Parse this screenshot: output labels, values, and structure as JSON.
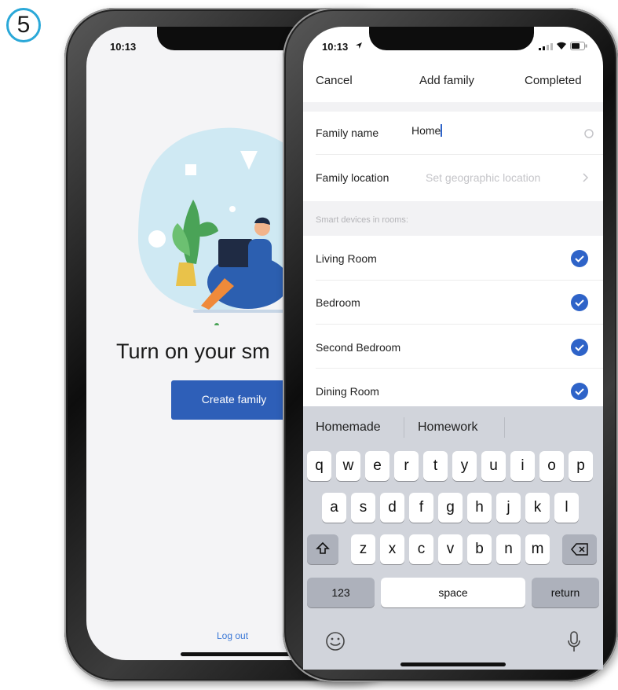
{
  "step_number": "5",
  "back_phone": {
    "time": "10:13",
    "heading": "Turn on your sm",
    "create_button": "Create family",
    "logout_link": "Log out"
  },
  "front_phone": {
    "time": "10:13",
    "nav": {
      "cancel": "Cancel",
      "title": "Add family",
      "completed": "Completed"
    },
    "family_name_label": "Family name",
    "family_name_value": "Home",
    "family_location_label": "Family location",
    "family_location_placeholder": "Set geographic location",
    "rooms_header": "Smart devices in rooms:",
    "rooms": [
      {
        "name": "Living Room",
        "checked": true
      },
      {
        "name": "Bedroom",
        "checked": true
      },
      {
        "name": "Second Bedroom",
        "checked": true
      },
      {
        "name": "Dining Room",
        "checked": true
      }
    ]
  },
  "keyboard": {
    "suggestions": [
      "Homemade",
      "Homework"
    ],
    "row1": [
      "q",
      "w",
      "e",
      "r",
      "t",
      "y",
      "u",
      "i",
      "o",
      "p"
    ],
    "row2": [
      "a",
      "s",
      "d",
      "f",
      "g",
      "h",
      "j",
      "k",
      "l"
    ],
    "row3": [
      "z",
      "x",
      "c",
      "v",
      "b",
      "n",
      "m"
    ],
    "num_key": "123",
    "space_key": "space",
    "return_key": "return"
  },
  "colors": {
    "accent_blue": "#2e5fb8",
    "check_blue": "#2e63c8",
    "badge_cyan": "#2aa8d8"
  },
  "icons": [
    "location-arrow-icon",
    "signal-icon",
    "wifi-icon",
    "battery-icon",
    "clear-icon",
    "chevron-right-icon",
    "check-icon",
    "shift-icon",
    "backspace-icon",
    "emoji-icon",
    "microphone-icon"
  ]
}
